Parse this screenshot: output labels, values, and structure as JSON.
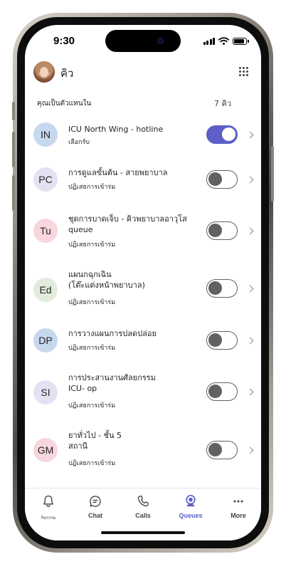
{
  "status_bar": {
    "time": "9:30"
  },
  "header": {
    "title": "คิว"
  },
  "section": {
    "label": "คุณเป็นตัวแทนใน",
    "count": "7 คิว"
  },
  "queues": [
    {
      "initials": "IN",
      "name": "ICU North Wing - hotline",
      "status": "เลือกรับ",
      "toggle_on": true,
      "avatar_color": "#c7d8ee"
    },
    {
      "initials": "PC",
      "name": "การดูแลขั้นต้น - สายพยาบาล",
      "status": "ปฏิเสธการเข้าร่ม",
      "toggle_on": false,
      "avatar_color": "#e4e2f2"
    },
    {
      "initials": "Tu",
      "name": "ชุดการบาดเจ็บ - คิวพยาบาลอาวุโส\nqueue",
      "status": "ปฏิเสธการเข้าร่ม",
      "toggle_on": false,
      "avatar_color": "#f8d6de"
    },
    {
      "initials": "Ed",
      "name": "แผนกฉุกเฉิน\n(โต๊ะแต่งหน้าพยาบาล)",
      "status": "ปฏิเสธการเข้าร่ม",
      "toggle_on": false,
      "avatar_color": "#e2ecdc"
    },
    {
      "initials": "DP",
      "name": "การวางแผนการปลดปล่อย",
      "status": "ปฏิเสธการเข้าร่ม",
      "toggle_on": false,
      "avatar_color": "#c7d8ee"
    },
    {
      "initials": "SI",
      "name": "การประสานงานศัลยกรรม\nICU- op",
      "status": "ปฏิเสธการเข้าร่ม",
      "toggle_on": false,
      "avatar_color": "#e4e2f2"
    },
    {
      "initials": "GM",
      "name": "ยาทั่วไป - ชั้น 5\nสถานี",
      "status": "ปฏิเสธการเข้าร่ม",
      "toggle_on": false,
      "avatar_color": "#f8d6de"
    }
  ],
  "tabs": [
    {
      "label": "กิจกรรม",
      "icon": "bell-icon",
      "active": false
    },
    {
      "label": "Chat",
      "icon": "chat-icon",
      "active": false
    },
    {
      "label": "Calls",
      "icon": "phone-icon",
      "active": false
    },
    {
      "label": "Queues",
      "icon": "queues-icon",
      "active": true
    },
    {
      "label": "More",
      "icon": "more-icon",
      "active": false
    }
  ],
  "colors": {
    "accent": "#5b5fc7",
    "text": "#242424",
    "toggle_off": "#616161"
  }
}
